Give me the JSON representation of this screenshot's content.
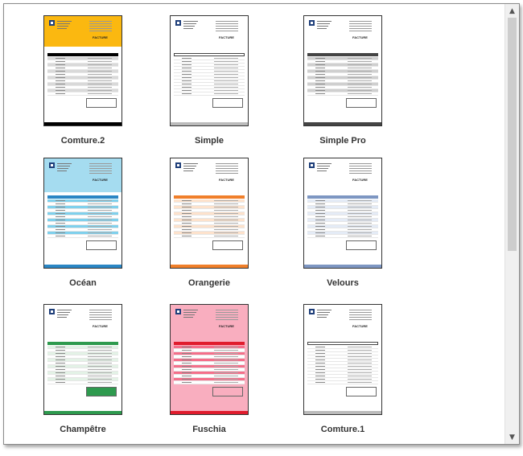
{
  "templates": [
    {
      "name": "Comture.2",
      "title": "FACTURE",
      "accent": "#fbb810",
      "header": "#000000",
      "stripe": "#d9d9d9"
    },
    {
      "name": "Simple",
      "title": "FACTURE",
      "accent": "#ffffff",
      "header": "#ffffff",
      "stripe": "#ffffff"
    },
    {
      "name": "Simple Pro",
      "title": "FACTURE",
      "accent": "#ffffff",
      "header": "#444444",
      "stripe": "#cfcfcf"
    },
    {
      "name": "Océan",
      "title": "FACTURE",
      "accent": "#a5dcf0",
      "header": "#2a86c4",
      "stripe": "#7fd0ec"
    },
    {
      "name": "Orangerie",
      "title": "FACTURE",
      "accent": "#ffffff",
      "header": "#f07f2a",
      "stripe": "#fde2cc"
    },
    {
      "name": "Velours",
      "title": "FACTURE",
      "accent": "#ffffff",
      "header": "#7d96c2",
      "stripe": "#e4ebf6"
    },
    {
      "name": "Champêtre",
      "title": "FACTURE",
      "accent": "#ffffff",
      "header": "#2e9a4e",
      "stripe": "#e3f2e6"
    },
    {
      "name": "Fuschia",
      "title": "FACTURE",
      "accent": "#f9aebf",
      "header": "#e01c2d",
      "stripe": "#f46f8a"
    },
    {
      "name": "Comture.1",
      "title": "FACTURE",
      "accent": "#ffffff",
      "header": "#ffffff",
      "stripe": "#ffffff"
    }
  ],
  "scrollbar": {
    "up_icon": "▲",
    "down_icon": "▼"
  }
}
